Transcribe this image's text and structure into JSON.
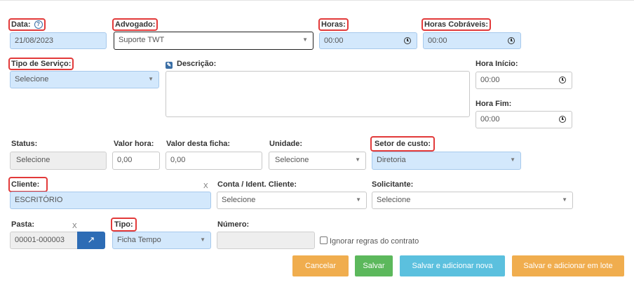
{
  "form": {
    "data": {
      "label": "Data:",
      "value": "21/08/2023"
    },
    "advogado": {
      "label": "Advogado:",
      "value": "Suporte TWT"
    },
    "horas": {
      "label": "Horas:",
      "value": "00:00"
    },
    "horas_cobraveis": {
      "label": "Horas Cobráveis:",
      "value": "00:00"
    },
    "tipo_servico": {
      "label": "Tipo de Serviço:",
      "value": "Selecione"
    },
    "descricao": {
      "label": "Descrição:",
      "value": ""
    },
    "hora_inicio": {
      "label": "Hora Início:",
      "value": "00:00"
    },
    "hora_fim": {
      "label": "Hora Fim:",
      "value": "00:00"
    },
    "status": {
      "label": "Status:",
      "value": "Selecione"
    },
    "valor_hora": {
      "label": "Valor hora:",
      "value": "0,00"
    },
    "valor_ficha": {
      "label": "Valor desta ficha:",
      "value": "0,00"
    },
    "unidade": {
      "label": "Unidade:",
      "value": "Selecione"
    },
    "setor_custo": {
      "label": "Setor de custo:",
      "value": "Diretoria"
    },
    "cliente": {
      "label": "Cliente:",
      "value": "ESCRITÓRIO",
      "clear": "X"
    },
    "conta_cliente": {
      "label": "Conta / Ident. Cliente:",
      "value": "Selecione"
    },
    "solicitante": {
      "label": "Solicitante:",
      "value": "Selecione"
    },
    "pasta": {
      "label": "Pasta:",
      "value": "00001-000003",
      "clear": "X"
    },
    "tipo": {
      "label": "Tipo:",
      "value": "Ficha Tempo"
    },
    "numero": {
      "label": "Número:",
      "value": ""
    },
    "ignorar": {
      "label": "Ignorar regras do contrato"
    }
  },
  "icons": {
    "help": "?",
    "edit": "✎",
    "open": "↗",
    "caret": "▼"
  },
  "buttons": {
    "cancelar": "Cancelar",
    "salvar": "Salvar",
    "salvar_nova": "Salvar e adicionar nova",
    "salvar_lote": "Salvar e adicionar em lote"
  },
  "colors": {
    "cancel": "#f0ad4e",
    "save": "#5cb85c",
    "save_new": "#5bc0de",
    "save_batch": "#f0ad4e",
    "highlight": "#e23a3a",
    "field_blue": "#d3e8fc"
  }
}
